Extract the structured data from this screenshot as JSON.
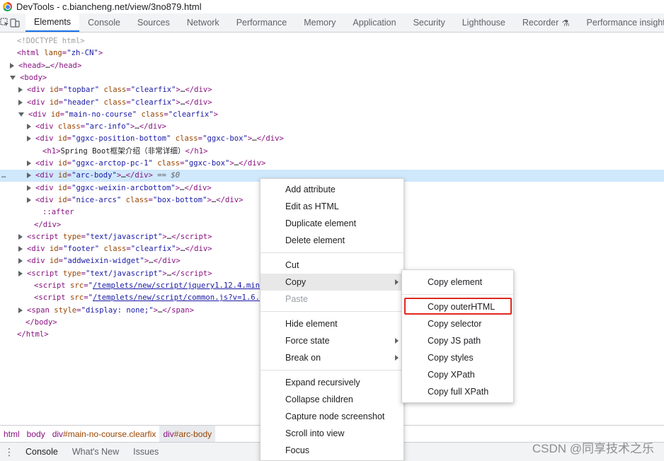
{
  "window": {
    "title": "DevTools - c.biancheng.net/view/3no879.html"
  },
  "tabs": [
    "Elements",
    "Console",
    "Sources",
    "Network",
    "Performance",
    "Memory",
    "Application",
    "Security",
    "Lighthouse",
    "Recorder",
    "Performance insights"
  ],
  "active_tab": "Elements",
  "dom_lines": [
    {
      "indent": 0,
      "tri": "none",
      "html": "<span class='comment'>&lt;!DOCTYPE html&gt;</span>"
    },
    {
      "indent": 0,
      "tri": "none",
      "html": "<span class='tag'>&lt;html</span> <span class='attr'>lang</span><span class='tag'>=</span><span class='val'>\"zh-CN\"</span><span class='tag'>&gt;</span>"
    },
    {
      "indent": 1,
      "tri": "right",
      "html": "<span class='tag'>&lt;head&gt;</span><span class='text'>…</span><span class='tag'>&lt;/head&gt;</span>"
    },
    {
      "indent": 1,
      "tri": "down",
      "html": "<span class='tag'>&lt;body&gt;</span>"
    },
    {
      "indent": 2,
      "tri": "right",
      "html": "<span class='tag'>&lt;div</span> <span class='attr'>id</span><span class='tag'>=</span><span class='val'>\"topbar\"</span> <span class='attr'>class</span><span class='tag'>=</span><span class='val'>\"clearfix\"</span><span class='tag'>&gt;</span><span class='text'>…</span><span class='tag'>&lt;/div&gt;</span>"
    },
    {
      "indent": 2,
      "tri": "right",
      "html": "<span class='tag'>&lt;div</span> <span class='attr'>id</span><span class='tag'>=</span><span class='val'>\"header\"</span> <span class='attr'>class</span><span class='tag'>=</span><span class='val'>\"clearfix\"</span><span class='tag'>&gt;</span><span class='text'>…</span><span class='tag'>&lt;/div&gt;</span>"
    },
    {
      "indent": 2,
      "tri": "down",
      "html": "<span class='tag'>&lt;div</span> <span class='attr'>id</span><span class='tag'>=</span><span class='val'>\"main-no-course\"</span> <span class='attr'>class</span><span class='tag'>=</span><span class='val'>\"clearfix\"</span><span class='tag'>&gt;</span>"
    },
    {
      "indent": 3,
      "tri": "right",
      "html": "<span class='tag'>&lt;div</span> <span class='attr'>class</span><span class='tag'>=</span><span class='val'>\"arc-info\"</span><span class='tag'>&gt;</span><span class='text'>…</span><span class='tag'>&lt;/div&gt;</span>"
    },
    {
      "indent": 3,
      "tri": "right",
      "html": "<span class='tag'>&lt;div</span> <span class='attr'>id</span><span class='tag'>=</span><span class='val'>\"ggxc-position-bottom\"</span> <span class='attr'>class</span><span class='tag'>=</span><span class='val'>\"ggxc-box\"</span><span class='tag'>&gt;</span><span class='text'>…</span><span class='tag'>&lt;/div&gt;</span>"
    },
    {
      "indent": 3,
      "tri": "none",
      "html": "<span class='tag'>&lt;h1&gt;</span><span class='text'>Spring Boot框架介绍（非常详细）</span><span class='tag'>&lt;/h1&gt;</span>"
    },
    {
      "indent": 3,
      "tri": "right",
      "html": "<span class='tag'>&lt;div</span> <span class='attr'>id</span><span class='tag'>=</span><span class='val'>\"ggxc-arctop-pc-1\"</span> <span class='attr'>class</span><span class='tag'>=</span><span class='val'>\"ggxc-box\"</span><span class='tag'>&gt;</span><span class='text'>…</span><span class='tag'>&lt;/div&gt;</span>"
    },
    {
      "indent": 3,
      "tri": "right",
      "selected": true,
      "html": "<span class='tag'>&lt;div</span> <span class='attr'>id</span><span class='tag'>=</span><span class='val'>\"arc-body\"</span><span class='tag'>&gt;</span><span class='text'>…</span><span class='tag'>&lt;/div&gt;</span> <span class='dim'>== $0</span>"
    },
    {
      "indent": 3,
      "tri": "right",
      "html": "<span class='tag'>&lt;div</span> <span class='attr'>id</span><span class='tag'>=</span><span class='val'>\"ggxc-weixin-arcbottom\"</span><span class='tag'>&gt;</span><span class='text'>…</span><span class='tag'>&lt;/div&gt;</span>"
    },
    {
      "indent": 3,
      "tri": "right",
      "html": "<span class='tag'>&lt;div</span> <span class='attr'>id</span><span class='tag'>=</span><span class='val'>\"nice-arcs\"</span> <span class='attr'>class</span><span class='tag'>=</span><span class='val'>\"box-bottom\"</span><span class='tag'>&gt;</span><span class='text'>…</span><span class='tag'>&lt;/div&gt;</span>"
    },
    {
      "indent": 3,
      "tri": "none",
      "html": "<span class='pseudo'>::after</span>"
    },
    {
      "indent": 2,
      "tri": "none",
      "html": "<span class='tag'>&lt;/div&gt;</span>"
    },
    {
      "indent": 2,
      "tri": "right",
      "html": "<span class='tag'>&lt;script</span> <span class='attr'>type</span><span class='tag'>=</span><span class='val'>\"text/javascript\"</span><span class='tag'>&gt;</span><span class='text'>…</span><span class='tag'>&lt;/script&gt;</span>"
    },
    {
      "indent": 2,
      "tri": "right",
      "html": "<span class='tag'>&lt;div</span> <span class='attr'>id</span><span class='tag'>=</span><span class='val'>\"footer\"</span> <span class='attr'>class</span><span class='tag'>=</span><span class='val'>\"clearfix\"</span><span class='tag'>&gt;</span><span class='text'>…</span><span class='tag'>&lt;/div&gt;</span>"
    },
    {
      "indent": 2,
      "tri": "right",
      "html": "<span class='tag'>&lt;div</span> <span class='attr'>id</span><span class='tag'>=</span><span class='val'>\"addweixin-widget\"</span><span class='tag'>&gt;</span><span class='text'>…</span><span class='tag'>&lt;/div&gt;</span>"
    },
    {
      "indent": 2,
      "tri": "right",
      "html": "<span class='tag'>&lt;script</span> <span class='attr'>type</span><span class='tag'>=</span><span class='val'>\"text/javascript\"</span><span class='tag'>&gt;</span><span class='text'>…</span><span class='tag'>&lt;/script&gt;</span>"
    },
    {
      "indent": 2,
      "tri": "none",
      "html": "<span class='tag'>&lt;script</span> <span class='attr'>src</span><span class='tag'>=</span><span class='val'>\"</span><span class='link'>/templets/new/script/jquery1.12.4.min</span>"
    },
    {
      "indent": 2,
      "tri": "none",
      "html": "<span class='tag'>&lt;script</span> <span class='attr'>src</span><span class='tag'>=</span><span class='val'>\"</span><span class='link'>/templets/new/script/common.js?v=1.6.</span>"
    },
    {
      "indent": 2,
      "tri": "right",
      "html": "<span class='tag'>&lt;span</span> <span class='attr'>style</span><span class='tag'>=</span><span class='val'>\"display: none;\"</span><span class='tag'>&gt;</span><span class='text'>…</span><span class='tag'>&lt;/span&gt;</span>"
    },
    {
      "indent": 1,
      "tri": "none",
      "html": "<span class='tag'>&lt;/body&gt;</span>"
    },
    {
      "indent": 0,
      "tri": "none",
      "html": "<span class='tag'>&lt;/html&gt;</span>"
    }
  ],
  "breadcrumb": [
    "html",
    "body",
    "div#main-no-course.clearfix",
    "div#arc-body"
  ],
  "drawer": {
    "tabs": [
      "Console",
      "What's New",
      "Issues"
    ]
  },
  "context_menu": {
    "groups": [
      [
        "Add attribute",
        "Edit as HTML",
        "Duplicate element",
        "Delete element"
      ],
      [
        "Cut",
        "Copy",
        "Paste"
      ],
      [
        "Hide element",
        "Force state",
        "Break on"
      ],
      [
        "Expand recursively",
        "Collapse children",
        "Capture node screenshot",
        "Scroll into view",
        "Focus"
      ]
    ],
    "submenu_items": [
      "Copy",
      "Force state",
      "Break on"
    ],
    "disabled_items": [
      "Paste"
    ],
    "hovered_item": "Copy"
  },
  "copy_submenu": {
    "items": [
      "Copy element",
      "Copy outerHTML",
      "Copy selector",
      "Copy JS path",
      "Copy styles",
      "Copy XPath",
      "Copy full XPath"
    ],
    "highlighted": "Copy outerHTML"
  },
  "watermark": "CSDN @同享技术之乐",
  "colors": {
    "accent": "#1a73e8",
    "selection": "#cfe8fc",
    "highlight_box": "#e0281e",
    "tag": "#881280",
    "attr": "#994500",
    "value": "#1a1aa6"
  }
}
